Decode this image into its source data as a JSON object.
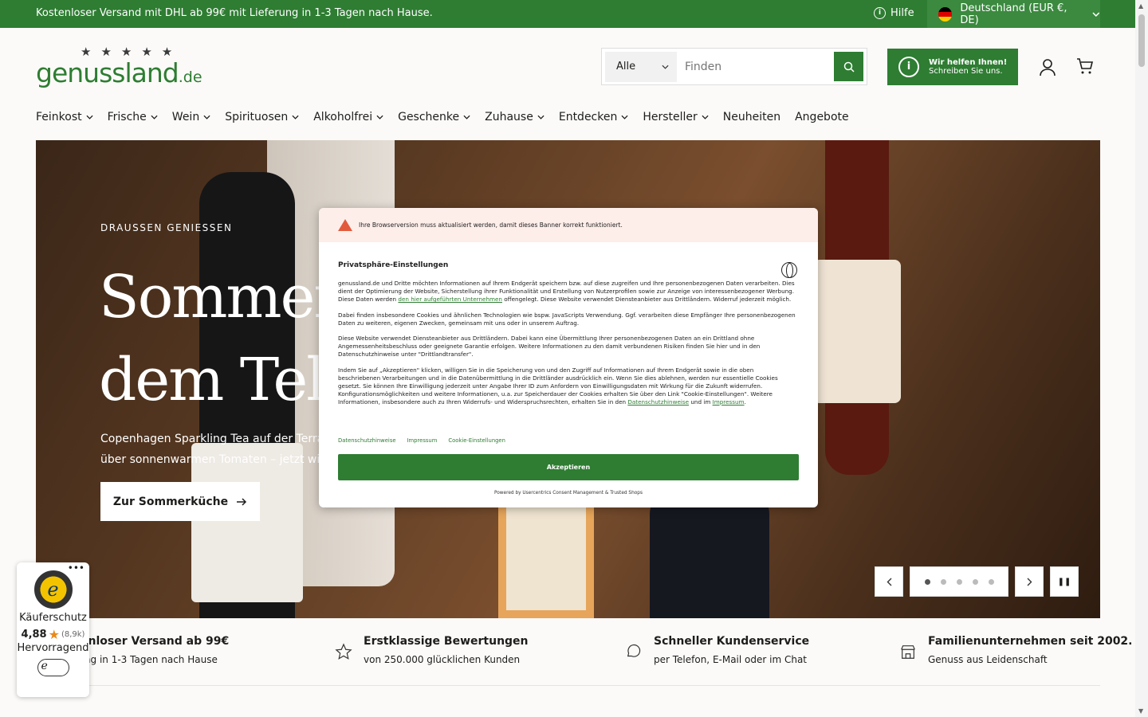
{
  "topbar": {
    "shipping": "Kostenloser Versand mit DHL ab 99€ mit Lieferung in 1-3 Tagen nach Hause.",
    "help": "Hilfe",
    "country": "Deutschland (EUR €, DE)"
  },
  "logo": {
    "name": "genussland",
    "tld": ".de",
    "stars": "★★★★★"
  },
  "search": {
    "category": "Alle",
    "placeholder": "Finden"
  },
  "helpbox": {
    "title": "Wir helfen Ihnen!",
    "subtitle": "Schreiben Sie uns."
  },
  "nav": [
    {
      "label": "Feinkost",
      "dropdown": true
    },
    {
      "label": "Frische",
      "dropdown": true
    },
    {
      "label": "Wein",
      "dropdown": true
    },
    {
      "label": "Spirituosen",
      "dropdown": true
    },
    {
      "label": "Alkoholfrei",
      "dropdown": true
    },
    {
      "label": "Geschenke",
      "dropdown": true
    },
    {
      "label": "Zuhause",
      "dropdown": true
    },
    {
      "label": "Entdecken",
      "dropdown": true
    },
    {
      "label": "Hersteller",
      "dropdown": true
    },
    {
      "label": "Neuheiten",
      "dropdown": false
    },
    {
      "label": "Angebote",
      "dropdown": false
    }
  ],
  "hero": {
    "kicker": "DRAUSSEN GENIESSEN",
    "headline": "Sommer\ndem Telle",
    "sub1": "Copenhagen Sparkling Tea auf der Terrass",
    "sub2": "über sonnenwarmen Tomaten – jetzt wird d",
    "cta": "Zur Sommerküche",
    "slides": 5,
    "active_slide": 1
  },
  "usps": [
    {
      "title": "stenloser Versand ab 99€",
      "sub": "erung in 1-3 Tagen nach Hause"
    },
    {
      "title": "Erstklassige Bewertungen",
      "sub": "von 250.000 glücklichen Kunden"
    },
    {
      "title": "Schneller Kundenservice",
      "sub": "per Telefon, E-Mail oder im Chat"
    },
    {
      "title": "Familienunternehmen seit 2002.",
      "sub": "Genuss aus Leidenschaft"
    }
  ],
  "trusted": {
    "label": "Käuferschutz",
    "score": "4,88",
    "count": "(8,9k)",
    "rating": "Hervorragend"
  },
  "cookie": {
    "warning": "Ihre Browserversion muss aktualisiert werden, damit dieses Banner korrekt funktioniert.",
    "title": "Privatsphäre-Einstellungen",
    "p1a": "genussland.de und Dritte möchten Informationen auf Ihrem Endgerät speichern bzw. auf diese zugreifen und Ihre personenbezogenen Daten verarbeiten. Dies dient der Optimierung der Website, Sicherstellung ihrer Funktionalität und Erstellung von Nutzerprofilen sowie zur Anzeige von interessenbezogener Werbung. Diese Daten werden ",
    "p1link": "den hier aufgeführten Unternehmen",
    "p1b": " offengelegt. Diese Website verwendet Diensteanbieter aus Drittländern. Widerruf jederzeit möglich.",
    "p2": "Dabei finden insbesondere Cookies und ähnlichen Technologien wie bspw. JavaScripts Verwendung. Ggf. verarbeiten diese Empfänger Ihre personenbezogenen Daten zu weiteren, eigenen Zwecken, gemeinsam mit uns oder in unserem Auftrag.",
    "p3": "Diese Website verwendet Diensteanbieter aus Drittländern. Dabei kann eine Übermittlung Ihrer personenbezogenen Daten an ein Drittland ohne Angemessenheitsbeschluss oder geeignete Garantie erfolgen. Weitere Informationen zu den damit verbundenen Risiken finden Sie hier und in den Datenschutzhinweise unter \"Drittlandtransfer\".",
    "p4a": "Indem Sie auf „Akzeptieren\" klicken, willigen Sie in die Speicherung von und den Zugriff auf Informationen auf Ihrem Endgerät sowie in die oben beschriebenen Verarbeitungen und in die Datenübermittlung in die Drittländer ausdrücklich ein. Wenn Sie dies ablehnen, werden nur essentielle Cookies gesetzt. Sie können Ihre Einwilligung jederzeit unter Angabe Ihrer ID zum Anfordern von Einwilligungsdaten mit Wirkung für die Zukunft widerrufen. Konfigurationsmöglichkeiten und weitere Informationen, u.a. zur Speicherdauer der Cookies erhalten Sie über den Link \"Cookie-Einstellungen\". Weitere Informationen, insbesondere auch zu Ihren Widerrufs- und Widerspruchsrechten, erhalten Sie in den ",
    "p4link1": "Datenschutzhinweise",
    "p4mid": " und im ",
    "p4link2": "Impressum",
    "p4end": ".",
    "links": [
      "Datenschutzhinweise",
      "Impressum",
      "Cookie-Einstellungen"
    ],
    "accept": "Akzeptieren",
    "powered": "Powered by Usercentrics Consent Management & Trusted Shops"
  },
  "colors": {
    "brand_green": "#2e7d32",
    "warning_bg": "#fdeeea",
    "warning_icon": "#e25a3c"
  }
}
